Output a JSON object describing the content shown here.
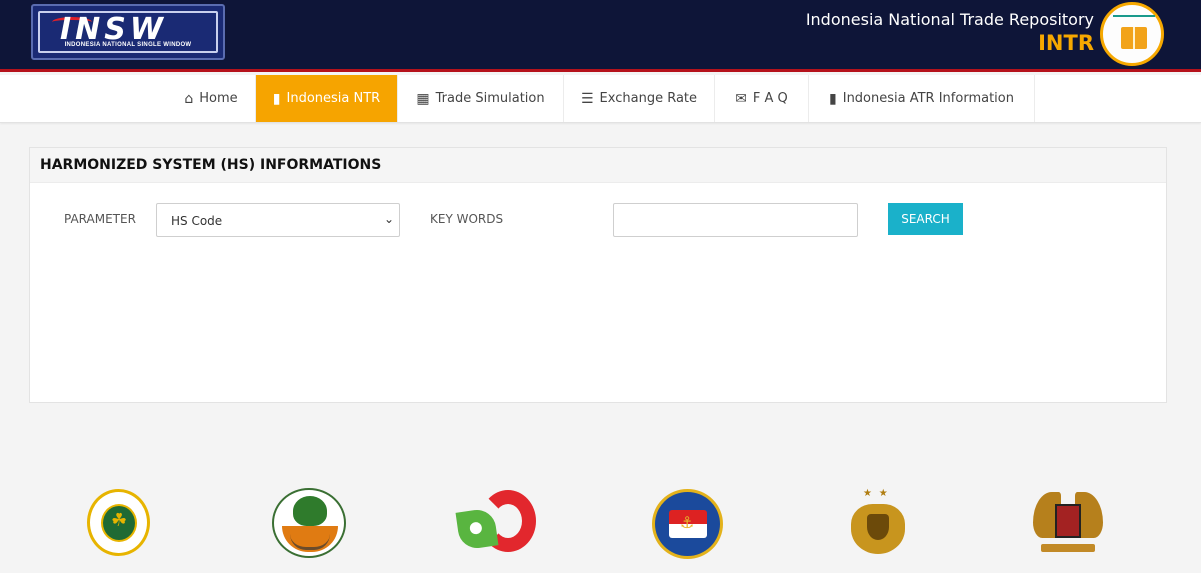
{
  "header": {
    "logo": {
      "word": "INSW",
      "subtitle": "INDONESIA NATIONAL SINGLE WINDOW"
    },
    "title": "Indonesia National Trade Repository",
    "code": "INTR"
  },
  "nav": {
    "items": [
      {
        "label": "Home",
        "icon": "home-icon",
        "active": false
      },
      {
        "label": "Indonesia NTR",
        "icon": "book-icon",
        "active": true
      },
      {
        "label": "Trade Simulation",
        "icon": "grid-icon",
        "active": false
      },
      {
        "label": "Exchange Rate",
        "icon": "barcode-icon",
        "active": false
      },
      {
        "label": "F A Q",
        "icon": "envelope-icon",
        "active": false
      },
      {
        "label": "Indonesia ATR Information",
        "icon": "book-icon",
        "active": false
      }
    ],
    "active_color": "#f6a400"
  },
  "panel": {
    "title": "HARMONIZED SYSTEM (HS) INFORMATIONS",
    "parameter_label": "PARAMETER",
    "parameter_value": "HS Code",
    "keywords_label": "KEY WORDS",
    "keywords_value": "",
    "search_label": "SEARCH",
    "search_color": "#1ab1ca"
  },
  "footer_logos": [
    {
      "name": "karantina-logo"
    },
    {
      "name": "lhk-logo"
    },
    {
      "name": "industri-logo"
    },
    {
      "name": "pertahanan-logo"
    },
    {
      "name": "polri-logo"
    },
    {
      "name": "garuda-logo"
    }
  ]
}
